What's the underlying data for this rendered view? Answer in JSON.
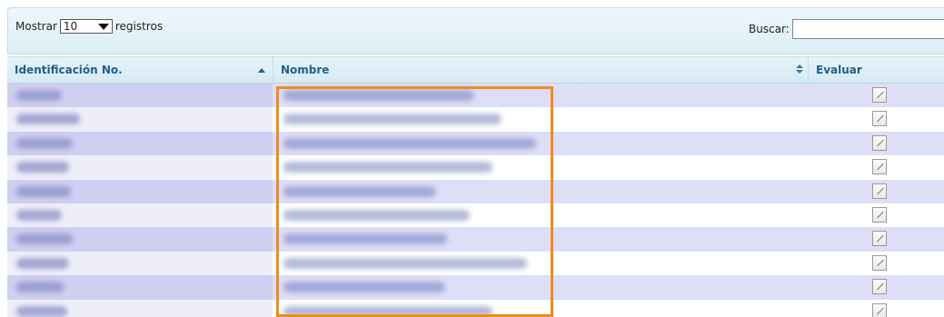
{
  "controls": {
    "show_label": "Mostrar",
    "page_size_value": "10",
    "records_label": "registros",
    "search_label": "Buscar:",
    "search_value": ""
  },
  "table": {
    "headers": {
      "id": "Identificación No.",
      "nombre": "Nombre",
      "evaluar": "Evaluar"
    },
    "sort_icon_id": "sort-asc-icon",
    "sort_icon_other": "sort-both-icon",
    "row_action_icon": "edit-icon",
    "rows": [
      {
        "id": "",
        "nombre": ""
      },
      {
        "id": "",
        "nombre": ""
      },
      {
        "id": "",
        "nombre": ""
      },
      {
        "id": "",
        "nombre": ""
      },
      {
        "id": "",
        "nombre": ""
      },
      {
        "id": "",
        "nombre": ""
      },
      {
        "id": "",
        "nombre": ""
      },
      {
        "id": "",
        "nombre": ""
      },
      {
        "id": "",
        "nombre": ""
      },
      {
        "id": "",
        "nombre": ""
      }
    ]
  },
  "colors": {
    "header_text": "#1f5f8b",
    "row_odd": "#dedef7",
    "row_even": "#ffffff",
    "highlight": "#f28a1c"
  }
}
